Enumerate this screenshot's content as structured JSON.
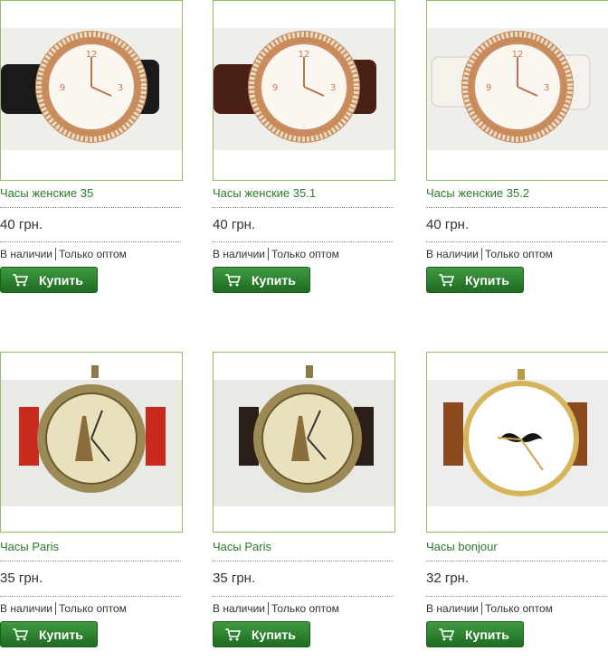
{
  "products": [
    {
      "name": "Часы женские 35",
      "price": "40 грн.",
      "in_stock": "В наличии",
      "wholesale": "Только оптом",
      "buy_label": "Купить"
    },
    {
      "name": "Часы женские 35.1",
      "price": "40 грн.",
      "in_stock": "В наличии",
      "wholesale": "Только оптом",
      "buy_label": "Купить"
    },
    {
      "name": "Часы женские 35.2",
      "price": "40 грн.",
      "in_stock": "В наличии",
      "wholesale": "Только оптом",
      "buy_label": "Купить"
    },
    {
      "name": "Часы Paris",
      "price": "35 грн.",
      "in_stock": "В наличии",
      "wholesale": "Только оптом",
      "buy_label": "Купить"
    },
    {
      "name": "Часы Paris",
      "price": "35 грн.",
      "in_stock": "В наличии",
      "wholesale": "Только оптом",
      "buy_label": "Купить"
    },
    {
      "name": "Часы bonjour",
      "price": "32 грн.",
      "in_stock": "В наличии",
      "wholesale": "Только оптом",
      "buy_label": "Купить"
    }
  ],
  "colors": {
    "link": "#2a7a2a",
    "button": "#2b8a2e",
    "border": "#8fbf5f"
  },
  "icons": {
    "cart": "cart-icon"
  }
}
